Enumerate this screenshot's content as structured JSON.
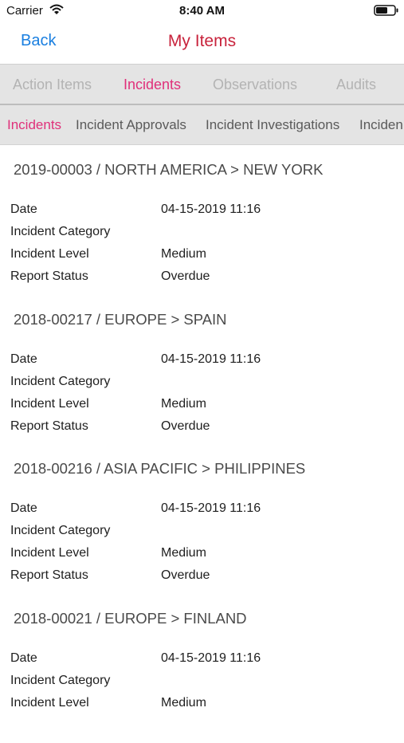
{
  "status_bar": {
    "carrier": "Carrier",
    "time": "8:40 AM"
  },
  "nav": {
    "back_label": "Back",
    "title": "My Items"
  },
  "primary_tabs": [
    {
      "label": "Action Items",
      "active": false
    },
    {
      "label": "Incidents",
      "active": true
    },
    {
      "label": "Observations",
      "active": false
    },
    {
      "label": "Audits",
      "active": false
    }
  ],
  "secondary_tabs": [
    {
      "label": "Incidents",
      "active": true
    },
    {
      "label": "Incident Approvals",
      "active": false
    },
    {
      "label": "Incident Investigations",
      "active": false
    },
    {
      "label": "Inciden",
      "active": false
    }
  ],
  "field_labels": {
    "date": "Date",
    "category": "Incident Category",
    "level": "Incident Level",
    "status": "Report Status"
  },
  "records": [
    {
      "header": "2019-00003 / NORTH AMERICA > NEW YORK",
      "date": "04-15-2019 11:16",
      "category": "",
      "level": "Medium",
      "status": "Overdue"
    },
    {
      "header": "2018-00217 / EUROPE > SPAIN",
      "date": "04-15-2019 11:16",
      "category": "",
      "level": "Medium",
      "status": "Overdue"
    },
    {
      "header": "2018-00216 / ASIA PACIFIC > PHILIPPINES",
      "date": "04-15-2019 11:16",
      "category": "",
      "level": "Medium",
      "status": "Overdue"
    },
    {
      "header": "2018-00021 / EUROPE > FINLAND",
      "date": "04-15-2019 11:16",
      "category": "",
      "level": "Medium",
      "status": ""
    }
  ],
  "colors": {
    "accent_pink": "#e0307a",
    "title_red": "#c8233c",
    "link_blue": "#1a7fe0",
    "tab_bg": "#e4e4e4"
  },
  "icons": {
    "wifi": "wifi-icon",
    "battery": "battery-icon"
  }
}
